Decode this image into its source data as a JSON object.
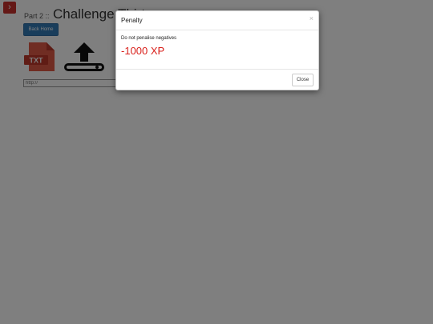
{
  "background": {
    "sidebar_toggle_glyph": "›",
    "heading_part": "Part 2 ::",
    "heading_title": "Challenge Thirteen",
    "back_button": "Back Home",
    "url_placeholder": "http://",
    "file_icon_text": "TXT"
  },
  "modal": {
    "title": "Penalty",
    "close_x": "×",
    "message": "Do not penalise negatives",
    "penalty": "-1000 XP",
    "close_button": "Close"
  },
  "colors": {
    "accent_red": "#c9302c",
    "penalty_red": "#d9211c",
    "primary_blue": "#337ab7"
  }
}
